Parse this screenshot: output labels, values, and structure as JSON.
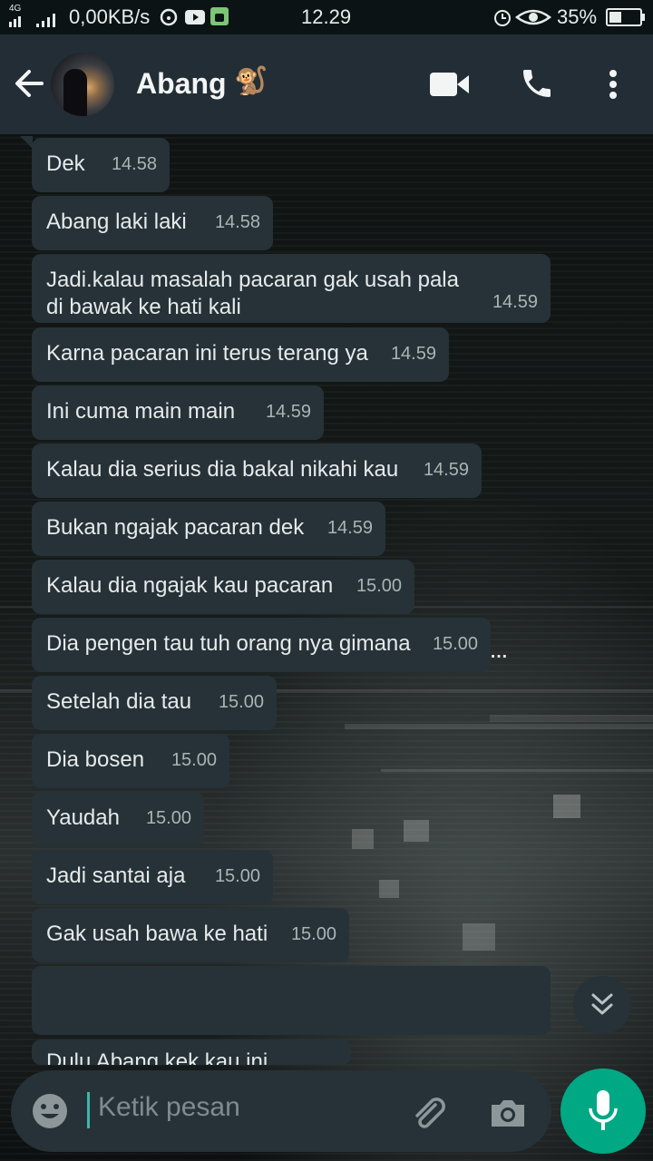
{
  "status_bar": {
    "network_type": "4G",
    "data_speed": "0,00KB/s",
    "time": "12.29",
    "battery": "35%",
    "icons": [
      "signal-icon",
      "steering-wheel-icon",
      "youtube-icon",
      "android-icon",
      "alarm-icon",
      "eye-icon",
      "battery-icon"
    ]
  },
  "header": {
    "contact_name": "Abang",
    "contact_emoji": "🐒",
    "icons": [
      "back-arrow-icon",
      "video-call-icon",
      "phone-call-icon",
      "more-vert-icon"
    ]
  },
  "messages": [
    {
      "text": "Dek",
      "time": "14.58"
    },
    {
      "text": "Abang laki laki",
      "time": "14.58"
    },
    {
      "text": "Jadi.kalau masalah pacaran gak usah pala di bawak ke hati kali",
      "time": "14.59"
    },
    {
      "text": "Karna pacaran ini terus terang ya",
      "time": "14.59"
    },
    {
      "text": "Ini cuma main main",
      "time": "14.59"
    },
    {
      "text": "Kalau dia serius dia bakal nikahi kau",
      "time": "14.59"
    },
    {
      "text": "Bukan ngajak pacaran dek",
      "time": "14.59"
    },
    {
      "text": "Kalau dia ngajak kau pacaran",
      "time": "15.00"
    },
    {
      "text": "Dia pengen tau tuh orang nya gimana",
      "time": "15.00"
    },
    {
      "text": "Setelah dia tau",
      "time": "15.00"
    },
    {
      "text": "Dia bosen",
      "time": "15.00"
    },
    {
      "text": "Yaudah",
      "time": "15.00"
    },
    {
      "text": "Jadi santai aja",
      "time": "15.00"
    },
    {
      "text": "Gak usah bawa ke hati",
      "time": "15.00"
    },
    {
      "text": "",
      "time": ""
    },
    {
      "text": "Dulu Abang kek kau ini",
      "time": ""
    }
  ],
  "input": {
    "placeholder": "Ketik pesan"
  },
  "colors": {
    "header_bg": "#232d36",
    "bubble_bg": "#263238",
    "accent": "#00a884"
  }
}
